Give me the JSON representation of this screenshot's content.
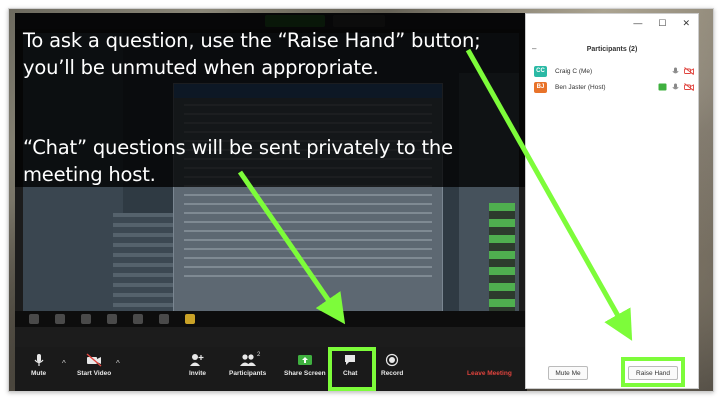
{
  "captions": {
    "raise_hand": "To ask a question, use the “Raise Hand” button; you’ll be unmuted when appropriate.",
    "chat": "“Chat” questions will be sent privately to the meeting host."
  },
  "toolbar": {
    "mute_label": "Mute",
    "start_video_label": "Start Video",
    "invite_label": "Invite",
    "participants_label": "Participants",
    "participants_count": "2",
    "share_screen_label": "Share Screen",
    "chat_label": "Chat",
    "record_label": "Record",
    "leave_label": "Leave Meeting"
  },
  "participants_panel": {
    "title": "Participants (2)",
    "items": [
      {
        "initials": "CC",
        "name": "Craig C (Me)",
        "avatar_color": "#2bb9a5"
      },
      {
        "initials": "BJ",
        "name": "Ben Jaster (Host)",
        "avatar_color": "#e8732a"
      }
    ],
    "mute_me_label": "Mute Me",
    "raise_hand_label": "Raise Hand"
  },
  "colors": {
    "highlight": "#7dfc3a",
    "arrow": "#7dfc3a",
    "leave": "#e0433d"
  }
}
